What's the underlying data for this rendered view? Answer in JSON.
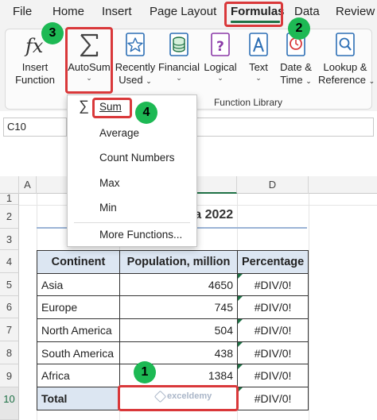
{
  "menu": {
    "items": [
      "File",
      "Home",
      "Insert",
      "Page Layout",
      "Formulas",
      "Data",
      "Review"
    ],
    "active": "Formulas"
  },
  "ribbon": {
    "insert_function": [
      "Insert",
      "Function"
    ],
    "autosum": "AutoSum",
    "recently_used": [
      "Recently",
      "Used"
    ],
    "financial": "Financial",
    "logical": "Logical",
    "text": "Text",
    "date_time": [
      "Date &",
      "Time"
    ],
    "lookup": [
      "Lookup &",
      "Reference"
    ],
    "group_label": "Function Library",
    "fx_glyph": "fx",
    "icons": {
      "insert_function": "fx-icon",
      "autosum": "sigma-icon",
      "recently_used": "star-book-icon",
      "financial": "database-coins-icon",
      "logical": "question-book-icon",
      "text": "letter-a-book-icon",
      "date_time": "clock-book-icon",
      "lookup": "magnifier-book-icon"
    }
  },
  "name_box": "C10",
  "columns": [
    "A",
    "B",
    "C",
    "D"
  ],
  "rows": [
    "1",
    "2",
    "3",
    "4",
    "5",
    "6",
    "7",
    "8",
    "9",
    "10"
  ],
  "sheet_title": "ata 2022",
  "table": {
    "headers": [
      "Continent",
      "Population, million",
      "Percentage"
    ],
    "rows": [
      {
        "continent": "Asia",
        "population": "4650",
        "percentage": "#DIV/0!"
      },
      {
        "continent": "Europe",
        "population": "745",
        "percentage": "#DIV/0!"
      },
      {
        "continent": "North America",
        "population": "504",
        "percentage": "#DIV/0!"
      },
      {
        "continent": "South America",
        "population": "438",
        "percentage": "#DIV/0!"
      },
      {
        "continent": "Africa",
        "population": "1384",
        "percentage": "#DIV/0!"
      }
    ],
    "total_label": "Total",
    "total_percentage": "#DIV/0!"
  },
  "autosum_menu": {
    "items": [
      "Sum",
      "Average",
      "Count Numbers",
      "Max",
      "Min",
      "More Functions..."
    ]
  },
  "badges": [
    "1",
    "2",
    "3",
    "4"
  ],
  "watermark": "exceldemy",
  "colors": {
    "excel_green": "#1e7145",
    "highlight_red": "#d9383a",
    "badge_green": "#1db954",
    "table_header_fill": "#dce6f2"
  }
}
